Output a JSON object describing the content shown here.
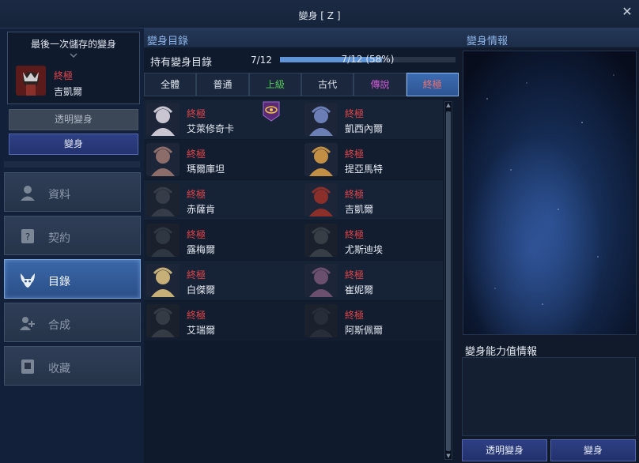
{
  "window": {
    "title": "變身 [ Z ]"
  },
  "left": {
    "last_saved_label": "最後一次儲存的變身",
    "last_saved": {
      "tier": "終極",
      "name": "吉凱爾"
    },
    "transparent_button": "透明變身",
    "transform_button": "變身",
    "nav": [
      {
        "label": "資料",
        "icon": "person-icon",
        "active": false
      },
      {
        "label": "契約",
        "icon": "contract-icon",
        "active": false
      },
      {
        "label": "目錄",
        "icon": "horned-mask-icon",
        "active": true
      },
      {
        "label": "合成",
        "icon": "merge-icon",
        "active": false
      },
      {
        "label": "收藏",
        "icon": "collection-icon",
        "active": false
      }
    ]
  },
  "catalog": {
    "header": "變身目錄",
    "owned_label": "持有變身目錄",
    "owned_count": "7/12",
    "progress_text": "7/12 (58%)",
    "progress": 0.58,
    "tabs": [
      {
        "label": "全體",
        "color": "#dfe5ee",
        "active": false
      },
      {
        "label": "普通",
        "color": "#dfe5ee",
        "active": false
      },
      {
        "label": "上級",
        "color": "#57c95a",
        "active": false
      },
      {
        "label": "古代",
        "color": "#dfe5ee",
        "active": false
      },
      {
        "label": "傳說",
        "color": "#d05bd6",
        "active": false
      },
      {
        "label": "終極",
        "color": "#f07070",
        "active": true
      }
    ],
    "items": [
      {
        "tier": "終極",
        "name": "艾萊修奇卡",
        "owned": true,
        "tone": "#c9c6d2"
      },
      {
        "tier": "終極",
        "name": "凱西內爾",
        "owned": true,
        "tone": "#6b7fb6"
      },
      {
        "tier": "終極",
        "name": "瑪爾庫坦",
        "owned": true,
        "tone": "#8d6d6a"
      },
      {
        "tier": "終極",
        "name": "提亞馬特",
        "owned": true,
        "tone": "#c28f45"
      },
      {
        "tier": "終極",
        "name": "赤薩肯",
        "owned": false,
        "tone": "#5a5f63"
      },
      {
        "tier": "終極",
        "name": "吉凱爾",
        "owned": true,
        "tone": "#8a2f2a"
      },
      {
        "tier": "終極",
        "name": "露梅爾",
        "owned": false,
        "tone": "#3f5c6e"
      },
      {
        "tier": "終極",
        "name": "尤斯迪埃",
        "owned": false,
        "tone": "#6c6650"
      },
      {
        "tier": "終極",
        "name": "白傑爾",
        "owned": true,
        "tone": "#c7b078"
      },
      {
        "tier": "終極",
        "name": "崔妮爾",
        "owned": true,
        "tone": "#6a4f6e"
      },
      {
        "tier": "終極",
        "name": "艾瑞爾",
        "owned": false,
        "tone": "#5c6068"
      },
      {
        "tier": "終極",
        "name": "阿斯佩爾",
        "owned": false,
        "tone": "#3f4648"
      }
    ]
  },
  "info": {
    "header": "變身情報",
    "stats_title": "變身能力值情報",
    "transparent_button": "透明變身",
    "transform_button": "變身"
  }
}
